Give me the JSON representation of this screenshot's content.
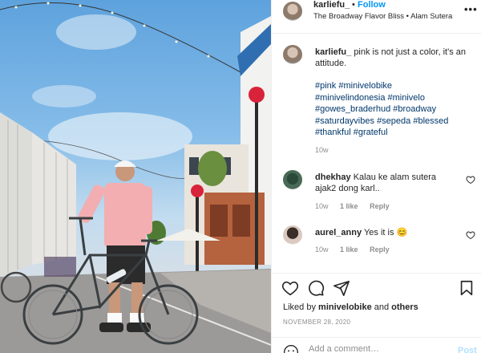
{
  "post": {
    "username": "karliefu_",
    "separator": "•",
    "follow_label": "Follow",
    "location": "The Broadway Flavor Bliss • Alam Sutera",
    "more_icon": "more-horizontal-icon"
  },
  "caption": {
    "username": "karliefu_",
    "text": "pink is not just a color, it's an attitude.",
    "hashtags": [
      "#pink",
      "#minivelobike",
      "#minivelindonesia",
      "#minivelo",
      "#gowes_braderhud",
      "#broadway",
      "#saturdayvibes",
      "#sepeda",
      "#blessed",
      "#thankful",
      "#grateful"
    ],
    "time": "10w"
  },
  "comments": [
    {
      "username": "dhekhay",
      "text": "Kalau ke alam sutera ajak2 dong karl..",
      "time": "10w",
      "likes": "1 like",
      "reply_label": "Reply"
    },
    {
      "username": "aurel_anny",
      "text": "Yes it is 😊",
      "time": "10w",
      "likes": "1 like",
      "reply_label": "Reply"
    }
  ],
  "actions": {
    "icons": [
      "heart-icon",
      "comment-icon",
      "share-icon",
      "bookmark-icon"
    ]
  },
  "likes": {
    "prefix": "Liked by",
    "user": "minivelobike",
    "joiner": "and",
    "others": "others"
  },
  "date": "NOVEMBER 28, 2020",
  "add_comment": {
    "placeholder": "Add a comment…",
    "post_label": "Post"
  },
  "colors": {
    "link_blue": "#0095f6",
    "hashtag": "#00376b",
    "muted": "#8e8e8e",
    "post_disabled": "#b2dffc"
  }
}
